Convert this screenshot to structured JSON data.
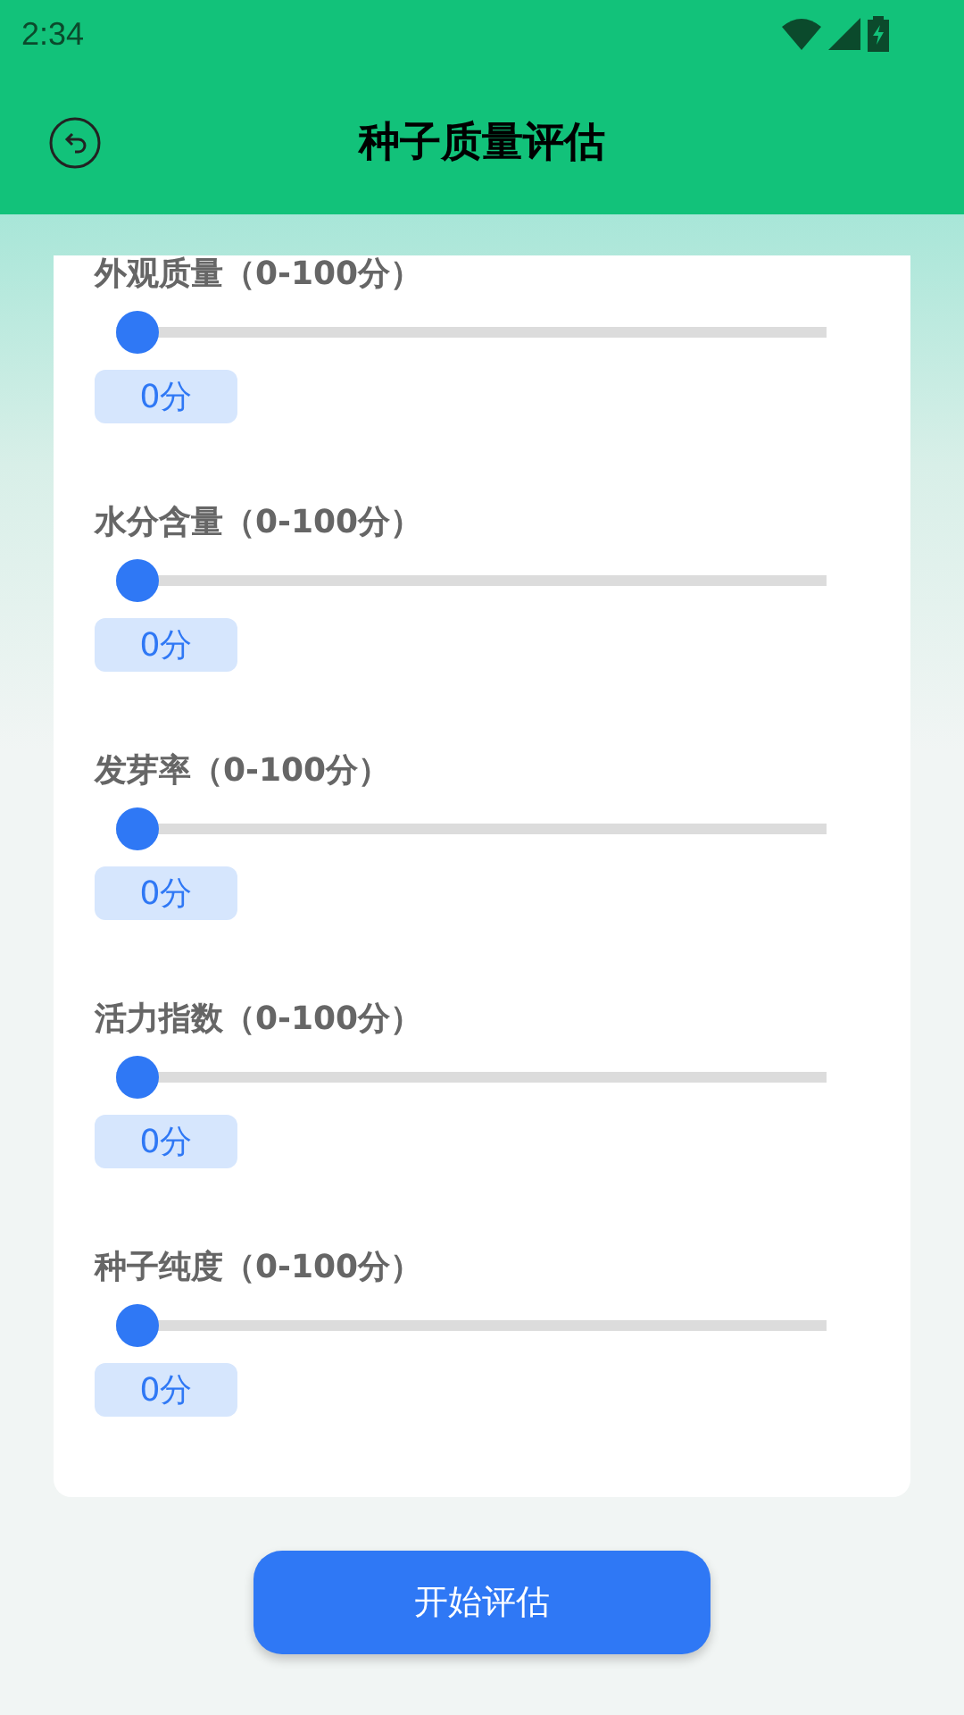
{
  "status_bar": {
    "time": "2:34"
  },
  "header": {
    "title": "种子质量评估"
  },
  "sliders": [
    {
      "label": "外观质量（0-100分）",
      "level": 0,
      "value": "0分"
    },
    {
      "label": "水分含量（0-100分）",
      "level": 0,
      "value": "0分"
    },
    {
      "label": "发芽率（0-100分）",
      "level": 0,
      "value": "0分"
    },
    {
      "label": "活力指数（0-100分）",
      "level": 0,
      "value": "0分"
    },
    {
      "label": "种子纯度（0-100分）",
      "level": 0,
      "value": "0分"
    }
  ],
  "start_button": {
    "label": "开始评估"
  }
}
